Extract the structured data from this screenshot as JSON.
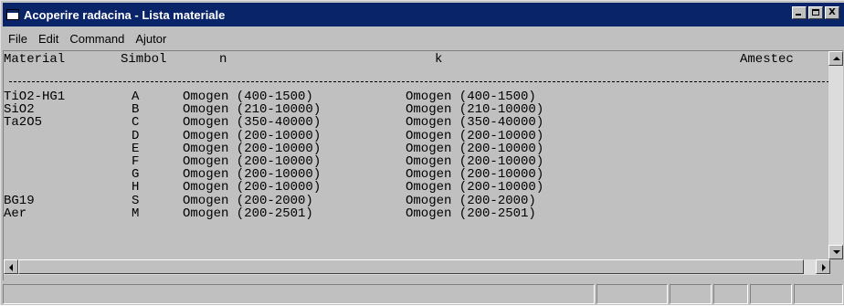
{
  "window": {
    "title": "Acoperire radacina - Lista materiale",
    "minimize_label": "_",
    "maximize_label": "",
    "close_label": "X"
  },
  "menu": [
    "File",
    "Edit",
    "Command",
    "Ajutor"
  ],
  "table": {
    "headers": {
      "material": "Material",
      "simbol": "Simbol",
      "n": "n",
      "k": "k",
      "amestec": "Amestec"
    },
    "separator": "----------------------------------------------------------------------------------------------------------------",
    "rows": [
      {
        "material": "TiO2-HG1",
        "simbol": "A",
        "n": "Omogen (400-1500)",
        "k": "Omogen (400-1500)"
      },
      {
        "material": "SiO2",
        "simbol": "B",
        "n": "Omogen (210-10000)",
        "k": "Omogen (210-10000)"
      },
      {
        "material": "Ta2O5",
        "simbol": "C",
        "n": "Omogen (350-40000)",
        "k": "Omogen (350-40000)"
      },
      {
        "material": "",
        "simbol": "D",
        "n": "Omogen (200-10000)",
        "k": "Omogen (200-10000)"
      },
      {
        "material": "",
        "simbol": "E",
        "n": "Omogen (200-10000)",
        "k": "Omogen (200-10000)"
      },
      {
        "material": "",
        "simbol": "F",
        "n": "Omogen (200-10000)",
        "k": "Omogen (200-10000)"
      },
      {
        "material": "",
        "simbol": "G",
        "n": "Omogen (200-10000)",
        "k": "Omogen (200-10000)"
      },
      {
        "material": "",
        "simbol": "H",
        "n": "Omogen (200-10000)",
        "k": "Omogen (200-10000)"
      },
      {
        "material": "BG19",
        "simbol": "S",
        "n": "Omogen (200-2000)",
        "k": "Omogen (200-2000)"
      },
      {
        "material": "Aer",
        "simbol": "M",
        "n": "Omogen (200-2501)",
        "k": "Omogen (200-2501)"
      }
    ]
  }
}
